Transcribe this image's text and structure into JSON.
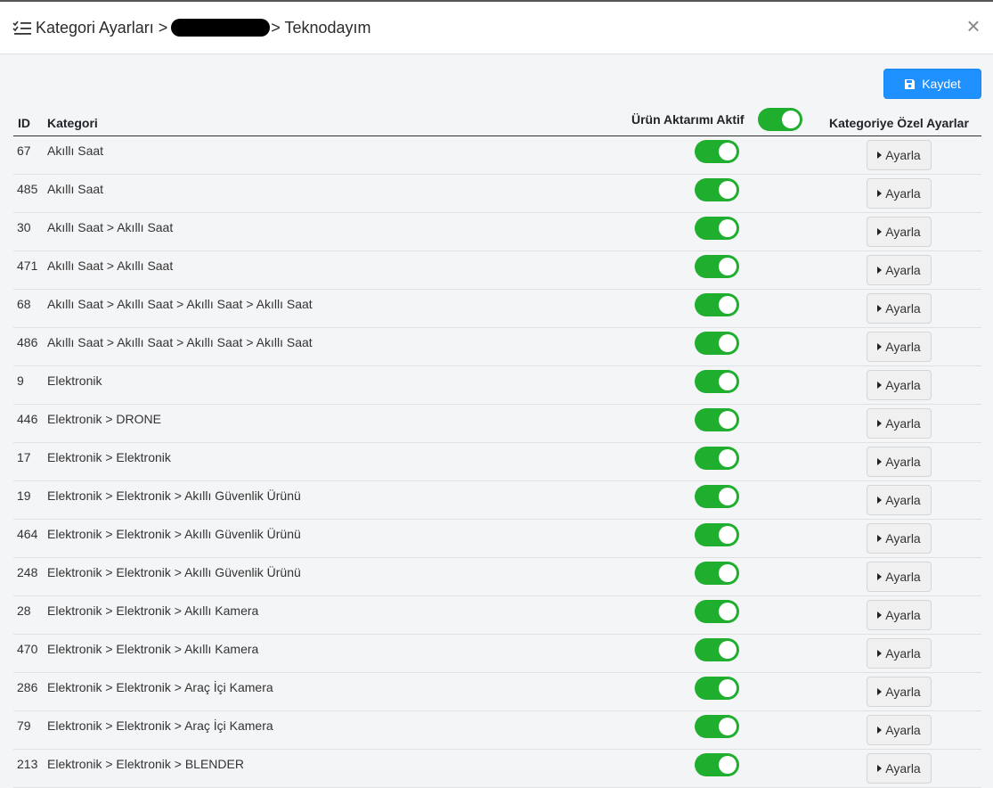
{
  "header": {
    "title_prefix": "Kategori Ayarları >",
    "title_suffix": "> Teknodayım",
    "close_label": "×"
  },
  "toolbar": {
    "save_label": "Kaydet"
  },
  "columns": {
    "id": "ID",
    "category": "Kategori",
    "transfer_active": "Ürün Aktarımı Aktif",
    "special_settings": "Kategoriye Özel Ayarlar"
  },
  "header_toggle_on": true,
  "button_label": "Ayarla",
  "rows": [
    {
      "id": "67",
      "category": "Akıllı Saat",
      "active": true
    },
    {
      "id": "485",
      "category": "Akıllı Saat",
      "active": true
    },
    {
      "id": "30",
      "category": "Akıllı Saat > Akıllı Saat",
      "active": true
    },
    {
      "id": "471",
      "category": "Akıllı Saat > Akıllı Saat",
      "active": true
    },
    {
      "id": "68",
      "category": "Akıllı Saat > Akıllı Saat > Akıllı Saat > Akıllı Saat",
      "active": true
    },
    {
      "id": "486",
      "category": "Akıllı Saat > Akıllı Saat > Akıllı Saat > Akıllı Saat",
      "active": true
    },
    {
      "id": "9",
      "category": "Elektronik",
      "active": true
    },
    {
      "id": "446",
      "category": "Elektronik > DRONE",
      "active": true
    },
    {
      "id": "17",
      "category": "Elektronik > Elektronik",
      "active": true
    },
    {
      "id": "19",
      "category": "Elektronik > Elektronik > Akıllı Güvenlik Ürünü",
      "active": true
    },
    {
      "id": "464",
      "category": "Elektronik > Elektronik > Akıllı Güvenlik Ürünü",
      "active": true
    },
    {
      "id": "248",
      "category": "Elektronik > Elektronik > Akıllı Güvenlik Ürünü",
      "active": true
    },
    {
      "id": "28",
      "category": "Elektronik > Elektronik > Akıllı Kamera",
      "active": true
    },
    {
      "id": "470",
      "category": "Elektronik > Elektronik > Akıllı Kamera",
      "active": true
    },
    {
      "id": "286",
      "category": "Elektronik > Elektronik > Araç İçi Kamera",
      "active": true
    },
    {
      "id": "79",
      "category": "Elektronik > Elektronik > Araç İçi Kamera",
      "active": true
    },
    {
      "id": "213",
      "category": "Elektronik > Elektronik > BLENDER",
      "active": true
    }
  ],
  "colors": {
    "toggle_on": "#1fae2e",
    "primary": "#1e90ff"
  }
}
